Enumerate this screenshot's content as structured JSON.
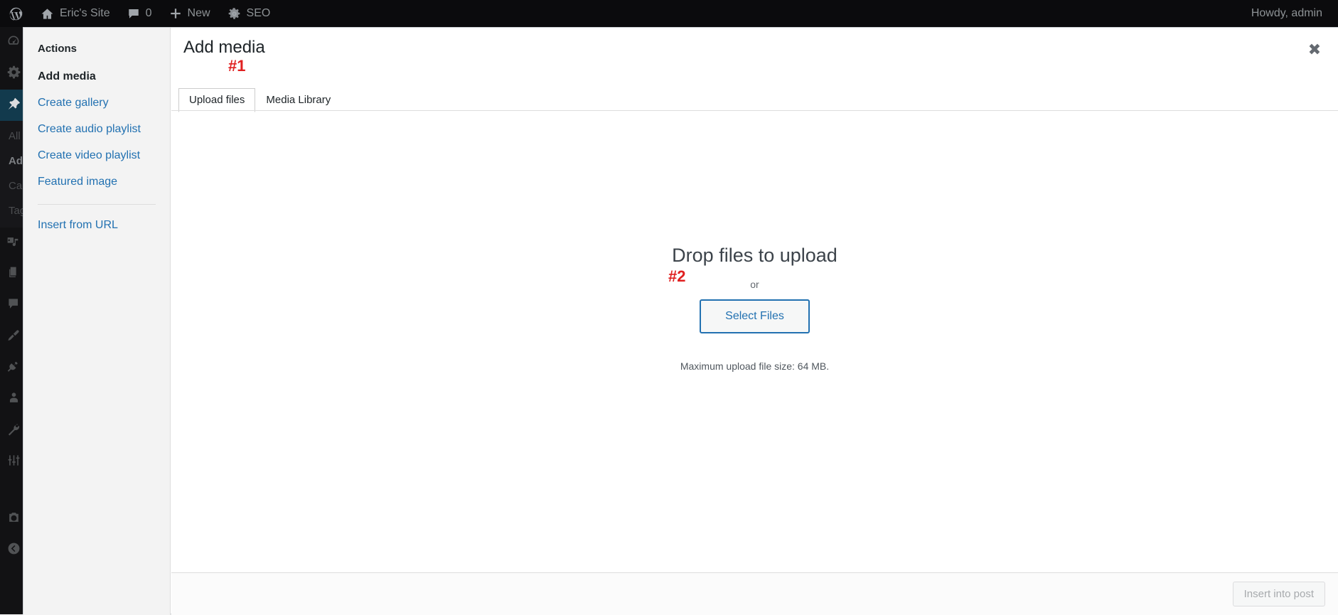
{
  "adminbar": {
    "items": [
      {
        "name": "wordpress-logo",
        "icon": "wordpress-icon",
        "label": ""
      },
      {
        "name": "site-name",
        "icon": "home-icon",
        "label": "Eric's Site"
      },
      {
        "name": "comments",
        "icon": "comment-icon",
        "label": "0"
      },
      {
        "name": "new-content",
        "icon": "plus-icon",
        "label": "New"
      },
      {
        "name": "seo",
        "icon": "gear-icon",
        "label": "SEO"
      }
    ],
    "howdy": "Howdy, admin"
  },
  "adminmenu": {
    "icons": [
      {
        "name": "dashboard",
        "icon": "dashboard-icon",
        "current": false
      },
      {
        "name": "seo",
        "icon": "gear-icon",
        "current": false
      },
      {
        "name": "posts",
        "icon": "pushpin-icon",
        "current": true
      }
    ],
    "submenu": [
      {
        "label": "All",
        "current": false
      },
      {
        "label": "Ad",
        "current": true
      },
      {
        "label": "Ca",
        "current": false
      },
      {
        "label": "Tag",
        "current": false
      }
    ],
    "icons_lower": [
      {
        "name": "media",
        "icon": "media-icon"
      },
      {
        "name": "pages",
        "icon": "pages-icon"
      },
      {
        "name": "comments",
        "icon": "comment-icon"
      },
      {
        "name": "appearance",
        "icon": "paintbrush-icon"
      },
      {
        "name": "plugins",
        "icon": "plug-icon"
      },
      {
        "name": "users",
        "icon": "user-icon"
      },
      {
        "name": "tools",
        "icon": "wrench-icon"
      },
      {
        "name": "settings",
        "icon": "sliders-icon"
      },
      {
        "name": "extra",
        "icon": "camera-icon"
      },
      {
        "name": "collapse",
        "icon": "collapse-icon"
      }
    ]
  },
  "modal": {
    "title": "Add media",
    "close_label": "✖",
    "sidebar": {
      "heading": "Actions",
      "links": [
        {
          "label": "Add media",
          "active": true
        },
        {
          "label": "Create gallery",
          "active": false
        },
        {
          "label": "Create audio playlist",
          "active": false
        },
        {
          "label": "Create video playlist",
          "active": false
        },
        {
          "label": "Featured image",
          "active": false
        }
      ],
      "secondary_links": [
        {
          "label": "Insert from URL",
          "active": false
        }
      ]
    },
    "tabs": [
      {
        "label": "Upload files",
        "active": true
      },
      {
        "label": "Media Library",
        "active": false
      }
    ],
    "dropzone": {
      "title": "Drop files to upload",
      "or": "or",
      "select_button": "Select Files",
      "max_size": "Maximum upload file size: 64 MB."
    },
    "footer": {
      "insert_button": "Insert into post"
    }
  },
  "annotations": [
    {
      "label": "#1",
      "target": "upload-files-tab"
    },
    {
      "label": "#2",
      "target": "select-files-button"
    }
  ],
  "colors": {
    "accent": "#2271b1",
    "annotation": "#e02020",
    "adminbar_bg": "#0b0b0d",
    "menu_current_bg": "#123a4d"
  }
}
